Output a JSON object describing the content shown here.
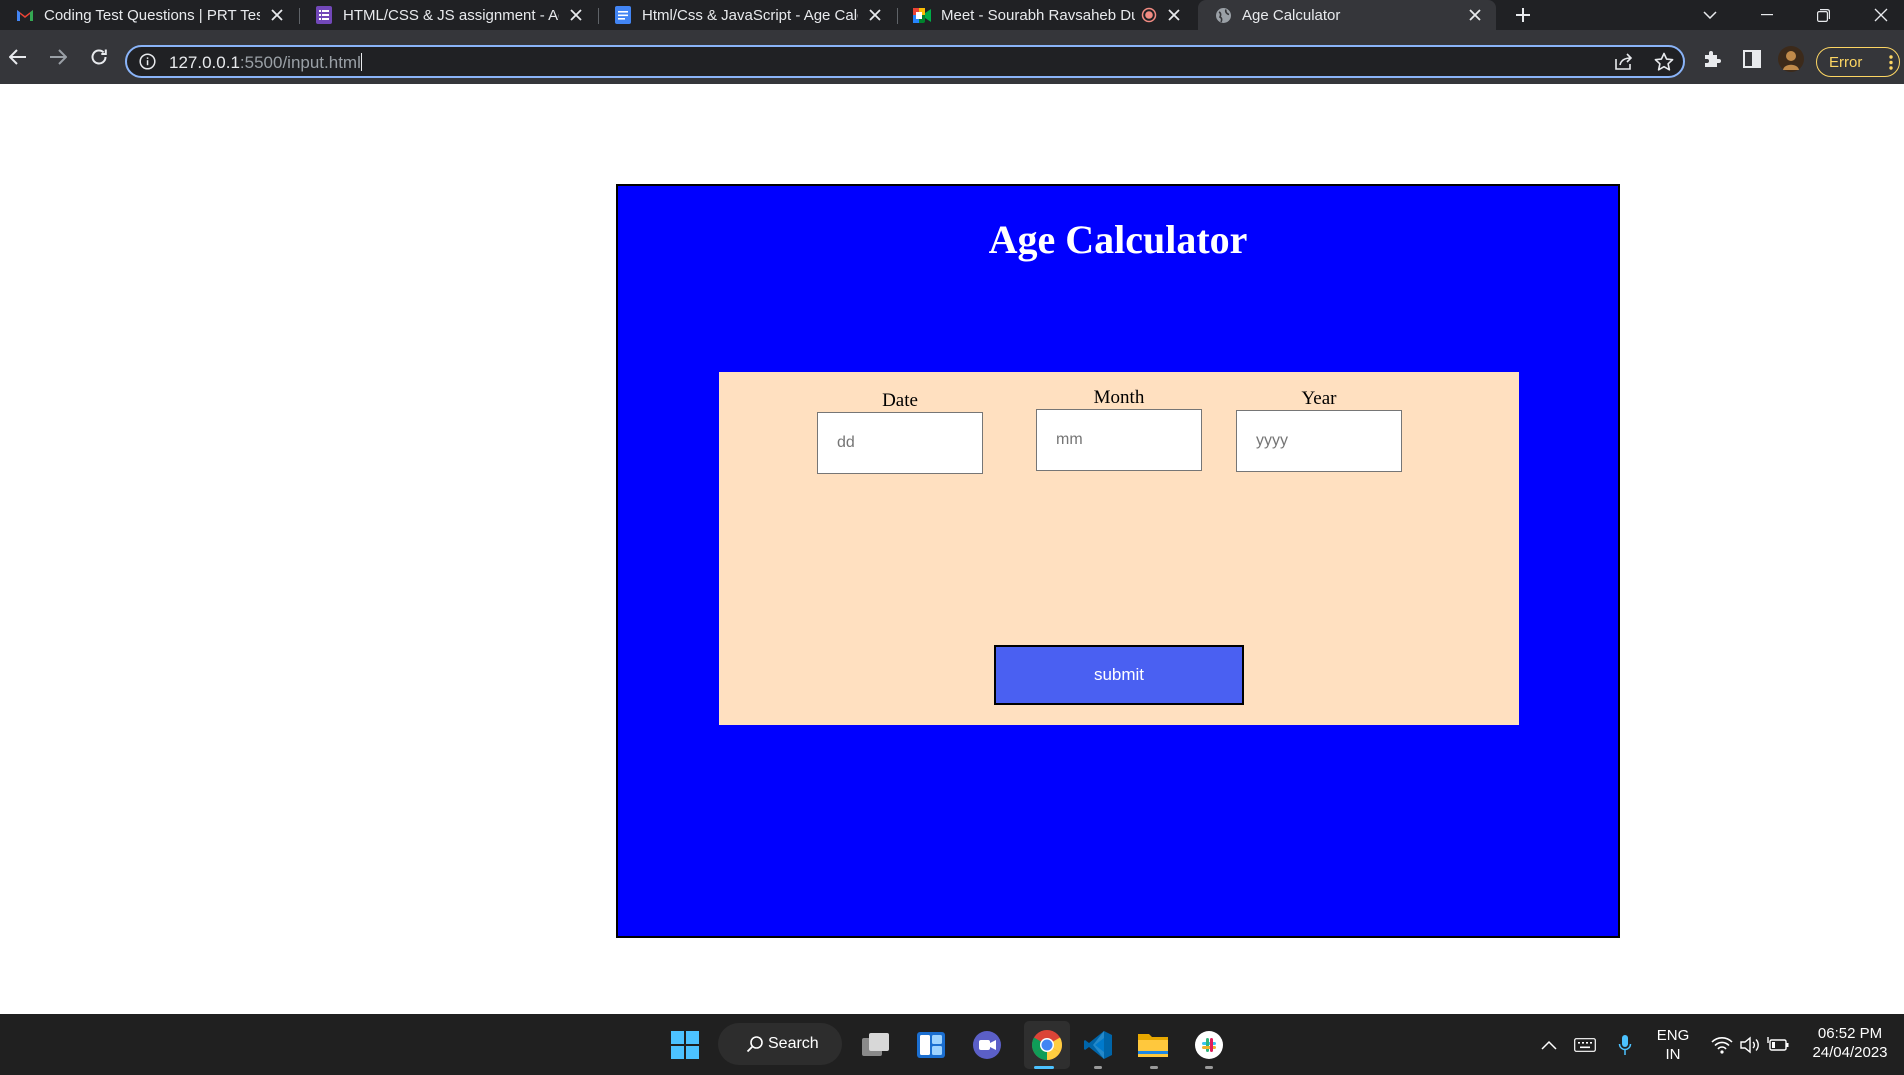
{
  "browser": {
    "tabs": [
      {
        "title": "Coding Test Questions | PRT Test",
        "icon": "gmail-icon"
      },
      {
        "title": "HTML/CSS & JS assignment - Ag",
        "icon": "forms-icon"
      },
      {
        "title": "Html/Css & JavaScript - Age Calc",
        "icon": "docs-icon"
      },
      {
        "title": "Meet - Sourabh Ravsaheb Du",
        "icon": "meet-icon"
      },
      {
        "title": "Age Calculator",
        "icon": "globe-icon"
      }
    ],
    "url_host": "127.0.0.1",
    "url_path": ":5500/input.html",
    "profile_status": "Error"
  },
  "page": {
    "heading": "Age Calculator",
    "fields": {
      "date": {
        "label": "Date",
        "placeholder": "dd"
      },
      "month": {
        "label": "Month",
        "placeholder": "mm"
      },
      "year": {
        "label": "Year",
        "placeholder": "yyyy"
      }
    },
    "submit_label": "submit",
    "colors": {
      "panel_bg": "#0000ff",
      "form_bg": "#ffe0c0",
      "submit_bg": "#4a60f2"
    }
  },
  "taskbar": {
    "search_label": "Search",
    "language": "ENG",
    "region": "IN",
    "time": "06:52 PM",
    "date": "24/04/2023"
  }
}
